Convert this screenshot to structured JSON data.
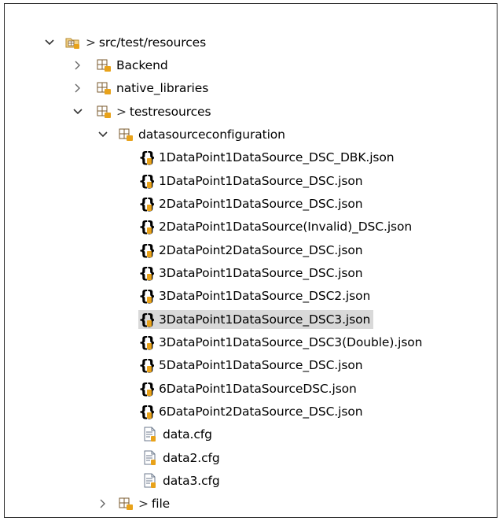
{
  "tree": {
    "root": {
      "prefix": ">",
      "label": "src/test/resources"
    },
    "backend": {
      "label": "Backend"
    },
    "native_libraries": {
      "label": "native_libraries"
    },
    "testresources": {
      "prefix": ">",
      "label": "testresources"
    },
    "datasourceconfiguration": {
      "label": "datasourceconfiguration"
    },
    "json_files": [
      "1DataPoint1DataSource_DSC_DBK.json",
      "1DataPoint1DataSource_DSC.json",
      "2DataPoint1DataSource_DSC.json",
      "2DataPoint1DataSource(Invalid)_DSC.json",
      "2DataPoint2DataSource_DSC.json",
      "3DataPoint1DataSource_DSC.json",
      "3DataPoint1DataSource_DSC2.json",
      "3DataPoint1DataSource_DSC3.json",
      "3DataPoint1DataSource_DSC3(Double).json",
      "5DataPoint1DataSource_DSC.json",
      "6DataPoint1DataSourceDSC.json",
      "6DataPoint2DataSource_DSC.json"
    ],
    "cfg_files": [
      "data.cfg",
      "data2.cfg",
      "data3.cfg"
    ],
    "file_folder": {
      "prefix": ">",
      "label": "file"
    },
    "selected_file": "3DataPoint1DataSource_DSC3.json"
  },
  "colors": {
    "selection": "#d9d9d9",
    "package_icon": "#7a5a2e",
    "package_overlay": "#e8a21a",
    "json_brace": "#000000",
    "json_overlay": "#e8a21a",
    "cfg_icon": "#6c7a8c"
  },
  "icons": {
    "expanded": "chevron-down-icon",
    "collapsed": "chevron-right-icon",
    "source_folder": "source-folder-icon",
    "package": "package-icon",
    "json_file": "json-file-icon",
    "cfg_file": "text-file-icon"
  }
}
